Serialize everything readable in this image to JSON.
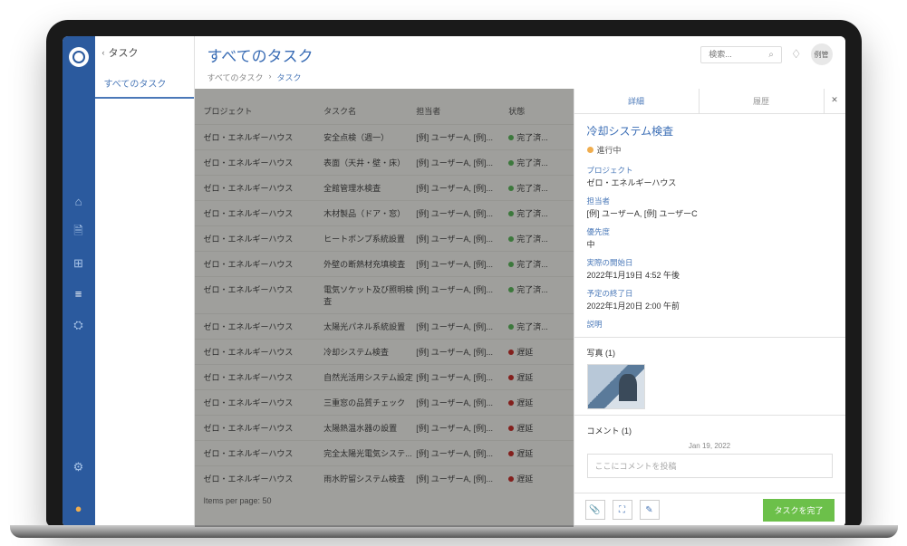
{
  "header": {
    "back_label": "タスク",
    "page_title": "すべてのタスク",
    "search_placeholder": "検索...",
    "avatar_initials": "例管"
  },
  "nav": {
    "item1": "すべてのタスク"
  },
  "breadcrumb": {
    "parent": "すべてのタスク",
    "sep": "›",
    "current": "タスク"
  },
  "table": {
    "headers": {
      "project": "プロジェクト",
      "task": "タスク名",
      "assignee": "担当者",
      "status": "状態"
    },
    "rows": [
      {
        "project": "ゼロ・エネルギーハウス",
        "task": "安全点検（週一）",
        "assignee": "[例] ユーザーA, [例]...",
        "status": "完了済...",
        "dot": "green"
      },
      {
        "project": "ゼロ・エネルギーハウス",
        "task": "表面（天井・壁・床）",
        "assignee": "[例] ユーザーA, [例]...",
        "status": "完了済...",
        "dot": "green"
      },
      {
        "project": "ゼロ・エネルギーハウス",
        "task": "全館管理水検査",
        "assignee": "[例] ユーザーA, [例]...",
        "status": "完了済...",
        "dot": "green"
      },
      {
        "project": "ゼロ・エネルギーハウス",
        "task": "木材製品（ドア・窓）",
        "assignee": "[例] ユーザーA, [例]...",
        "status": "完了済...",
        "dot": "green"
      },
      {
        "project": "ゼロ・エネルギーハウス",
        "task": "ヒートポンプ系統設置",
        "assignee": "[例] ユーザーA, [例]...",
        "status": "完了済...",
        "dot": "green"
      },
      {
        "project": "ゼロ・エネルギーハウス",
        "task": "外壁の断熱材充填検査",
        "assignee": "[例] ユーザーA, [例]...",
        "status": "完了済...",
        "dot": "green"
      },
      {
        "project": "ゼロ・エネルギーハウス",
        "task": "電気ソケット及び照明検査",
        "assignee": "[例] ユーザーA, [例]...",
        "status": "完了済...",
        "dot": "green"
      },
      {
        "project": "ゼロ・エネルギーハウス",
        "task": "太陽光パネル系統設置",
        "assignee": "[例] ユーザーA, [例]...",
        "status": "完了済...",
        "dot": "green"
      },
      {
        "project": "ゼロ・エネルギーハウス",
        "task": "冷却システム検査",
        "assignee": "[例] ユーザーA, [例]...",
        "status": "遅延",
        "dot": "red"
      },
      {
        "project": "ゼロ・エネルギーハウス",
        "task": "自然光活用システム設定",
        "assignee": "[例] ユーザーA, [例]...",
        "status": "遅延",
        "dot": "red"
      },
      {
        "project": "ゼロ・エネルギーハウス",
        "task": "三重窓の品質チェック",
        "assignee": "[例] ユーザーA, [例]...",
        "status": "遅延",
        "dot": "red"
      },
      {
        "project": "ゼロ・エネルギーハウス",
        "task": "太陽熱温水器の設置",
        "assignee": "[例] ユーザーA, [例]...",
        "status": "遅延",
        "dot": "red"
      },
      {
        "project": "ゼロ・エネルギーハウス",
        "task": "完全太陽光電気システ...",
        "assignee": "[例] ユーザーA, [例]...",
        "status": "遅延",
        "dot": "red"
      },
      {
        "project": "ゼロ・エネルギーハウス",
        "task": "雨水貯留システム検査",
        "assignee": "[例] ユーザーA, [例]...",
        "status": "遅延",
        "dot": "red"
      }
    ],
    "pager": "Items per page: 50"
  },
  "detail": {
    "tab1": "詳細",
    "tab2": "履歴",
    "close": "✕",
    "title": "冷却システム検査",
    "status": "進行中",
    "fields": {
      "project_label": "プロジェクト",
      "project_value": "ゼロ・エネルギーハウス",
      "assignee_label": "担当者",
      "assignee_value": "[例] ユーザーA, [例] ユーザーC",
      "priority_label": "優先度",
      "priority_value": "中",
      "start_label": "実際の開始日",
      "start_value": "2022年1月19日 4:52 午後",
      "due_label": "予定の終了日",
      "due_value": "2022年1月20日 2:00 午前",
      "desc_label": "説明"
    },
    "photos_label": "写真 (1)",
    "comments_label": "コメント (1)",
    "comment_date": "Jan 19, 2022",
    "comment_placeholder": "ここにコメントを投稿",
    "complete_btn": "タスクを完了"
  }
}
